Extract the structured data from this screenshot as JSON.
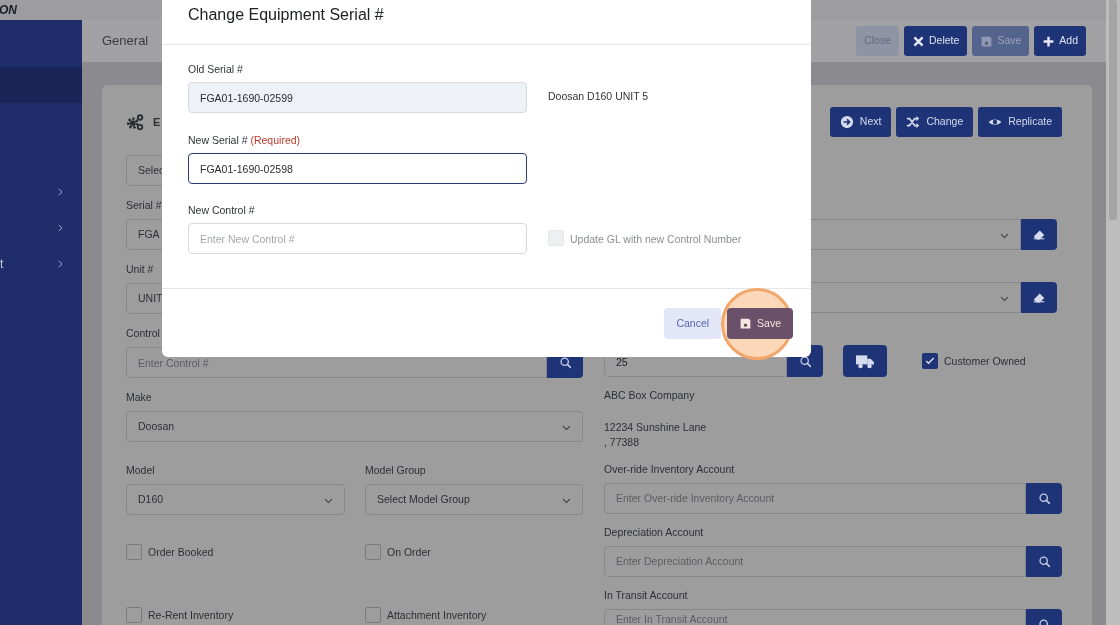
{
  "app_bar": {
    "logo": "ON"
  },
  "sidebar": {
    "items": [
      {
        "selected": true,
        "has_submenu": false
      },
      {
        "selected": false,
        "has_submenu": true
      },
      {
        "selected": false,
        "has_submenu": true
      },
      {
        "label": "t",
        "selected": false,
        "has_submenu": true
      }
    ]
  },
  "header": {
    "title": "General",
    "buttons": [
      {
        "kind": "close",
        "label": "Close",
        "disabled": true
      },
      {
        "kind": "delete",
        "label": "Delete",
        "disabled": false
      },
      {
        "kind": "save",
        "label": "Save",
        "disabled": true
      },
      {
        "kind": "add",
        "label": "Add",
        "disabled": false
      }
    ]
  },
  "form": {
    "title": "E",
    "actions": [
      {
        "kind": "next",
        "label": "Next"
      },
      {
        "kind": "change",
        "label": "Change"
      },
      {
        "kind": "replicate",
        "label": "Replicate"
      }
    ],
    "left": [
      {
        "kind": "covered_select",
        "value": "Selec"
      },
      {
        "kind": "input",
        "label": "Serial #",
        "value": "FGA"
      },
      {
        "kind": "input",
        "label": "Unit #",
        "value": "UNIT"
      },
      {
        "kind": "search",
        "label": "Control",
        "placeholder": "Enter Control #"
      },
      {
        "kind": "select",
        "label": "Make",
        "value": "Doosan"
      },
      {
        "kind": "pair",
        "items": [
          {
            "kind": "select",
            "label": "Model",
            "value": "D160"
          },
          {
            "kind": "select",
            "label": "Model Group",
            "value": "Select Model Group"
          }
        ]
      },
      {
        "kind": "checks",
        "items": [
          {
            "label": "Order Booked",
            "checked": false
          },
          {
            "label": "On Order",
            "checked": false
          }
        ]
      },
      {
        "kind": "checks",
        "items": [
          {
            "label": "Re-Rent Inventory",
            "checked": false
          },
          {
            "label": "Attachment Inventory",
            "checked": false
          }
        ]
      }
    ],
    "right": [
      {
        "kind": "clear_select"
      },
      {
        "kind": "clear_select"
      },
      {
        "kind": "customer",
        "value": "25",
        "check_label": "Customer Owned",
        "checked": true
      },
      {
        "kind": "text",
        "value": "ABC Box Company"
      },
      {
        "kind": "address",
        "lines": [
          "12234 Sunshine Lane",
          ", 77388"
        ]
      },
      {
        "kind": "search",
        "label": "Over-ride Inventory Account",
        "placeholder": "Enter Over-ride Inventory Account"
      },
      {
        "kind": "search",
        "label": "Depreciation Account",
        "placeholder": "Enter Depreciation Account"
      },
      {
        "kind": "search",
        "label": "In Transit Account",
        "placeholder": "Enter In Transit Account"
      }
    ]
  },
  "modal": {
    "title": "Change Equipment Serial #",
    "old_serial": {
      "label": "Old Serial #",
      "value": "FGA01-1690-02599",
      "readonly": true
    },
    "equipment_name": "Doosan D160 UNIT 5",
    "new_serial": {
      "label": "New Serial #",
      "required_note": "(Required)",
      "value": "FGA01-1690-02598",
      "focused": true
    },
    "new_control": {
      "label": "New Control #",
      "placeholder": "Enter New Control #"
    },
    "update_gl": {
      "label": "Update GL with new Control Number",
      "checked": false,
      "disabled": true
    },
    "buttons": [
      {
        "kind": "cancel",
        "label": "Cancel",
        "highlighted": false
      },
      {
        "kind": "save",
        "label": "Save",
        "highlighted": true
      }
    ]
  }
}
